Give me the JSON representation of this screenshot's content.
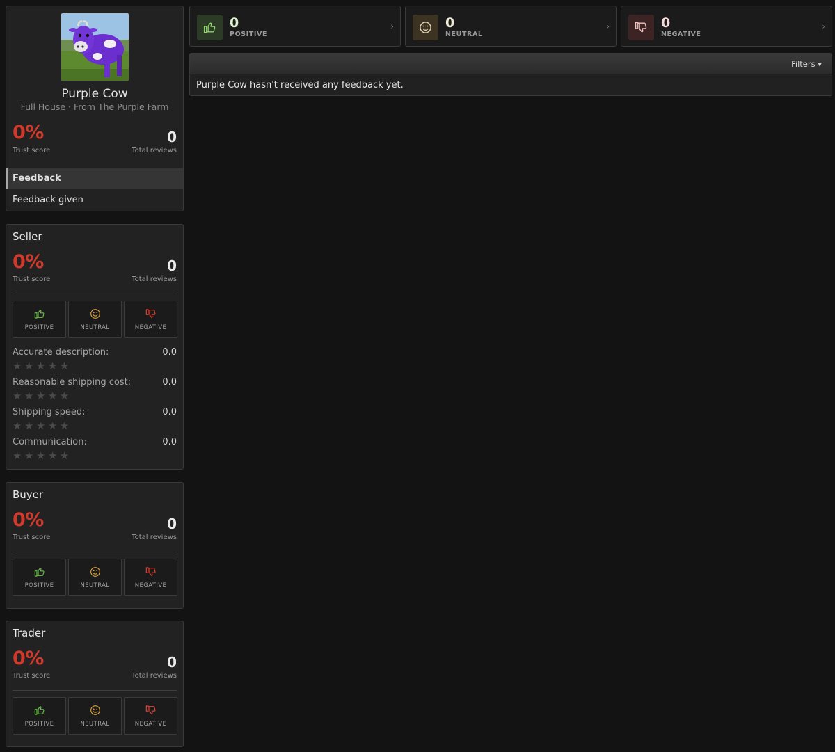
{
  "profile": {
    "name": "Purple Cow",
    "tagline": "Full House · From The Purple Farm",
    "trust_score": "0%",
    "trust_score_label": "Trust score",
    "total_reviews": "0",
    "total_reviews_label": "Total reviews"
  },
  "menu": {
    "feedback": "Feedback",
    "feedback_given": "Feedback given"
  },
  "labels": {
    "positive": "POSITIVE",
    "neutral": "NEUTRAL",
    "negative": "NEGATIVE",
    "positive_short": "POSITIVE",
    "neutral_short": "NEUTRAL",
    "negative_short": "NEGATIVE"
  },
  "seller": {
    "title": "Seller",
    "trust_score": "0%",
    "trust_score_label": "Trust score",
    "total_reviews": "0",
    "total_reviews_label": "Total reviews",
    "ratings": [
      {
        "label": "Accurate description:",
        "value": "0.0",
        "stars": 0
      },
      {
        "label": "Reasonable shipping cost:",
        "value": "0.0",
        "stars": 0
      },
      {
        "label": "Shipping speed:",
        "value": "0.0",
        "stars": 0
      },
      {
        "label": "Communication:",
        "value": "0.0",
        "stars": 0
      }
    ]
  },
  "buyer": {
    "title": "Buyer",
    "trust_score": "0%",
    "trust_score_label": "Trust score",
    "total_reviews": "0",
    "total_reviews_label": "Total reviews"
  },
  "trader": {
    "title": "Trader",
    "trust_score": "0%",
    "trust_score_label": "Trust score",
    "total_reviews": "0",
    "total_reviews_label": "Total reviews"
  },
  "summary": {
    "positive": {
      "count": "0",
      "label": "POSITIVE"
    },
    "neutral": {
      "count": "0",
      "label": "NEUTRAL"
    },
    "negative": {
      "count": "0",
      "label": "NEGATIVE"
    },
    "chevron": "›"
  },
  "feed": {
    "filters_label": "Filters ▾",
    "empty_message": "Purple Cow hasn't received any feedback yet."
  },
  "colors": {
    "positive": "#6cc24a",
    "neutral": "#e0a43a",
    "negative": "#d9473b",
    "score": "#cf3a2c"
  },
  "icons": {
    "positive": "thumbs-up-icon",
    "neutral": "smiley-icon",
    "negative": "thumbs-down-icon",
    "star": "★★★★★"
  }
}
